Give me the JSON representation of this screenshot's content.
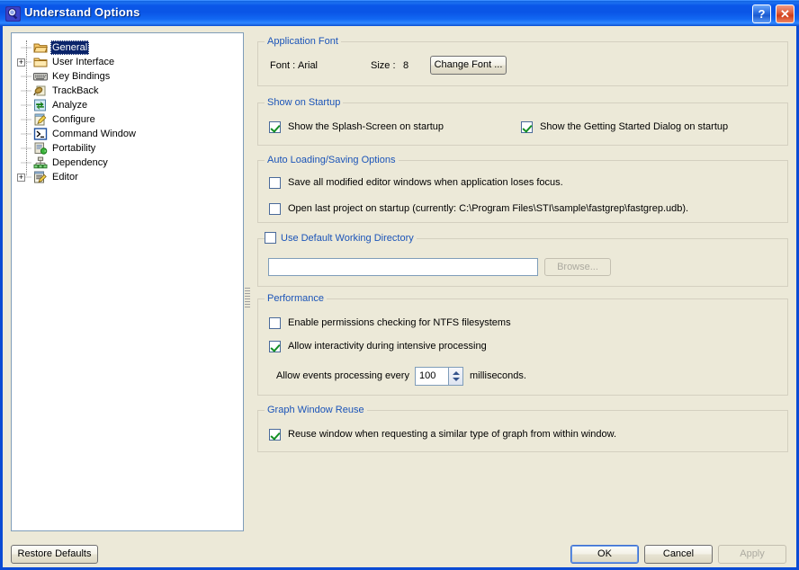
{
  "window": {
    "title": "Understand Options",
    "icon": "magnifier-icon",
    "help_button": "?",
    "close_button": "✕",
    "titlebar_color": "#0a55e6",
    "dialog_bg": "#ece9d8"
  },
  "tree": {
    "items": [
      {
        "label": "General",
        "icon": "folder-open-icon",
        "expander": "",
        "selected": true,
        "indent": 0
      },
      {
        "label": "User Interface",
        "icon": "folder-closed-icon",
        "expander": "+",
        "selected": false,
        "indent": 0
      },
      {
        "label": "Key Bindings",
        "icon": "keyboard-icon",
        "expander": "",
        "selected": false,
        "indent": 0
      },
      {
        "label": "TrackBack",
        "icon": "trackback-icon",
        "expander": "",
        "selected": false,
        "indent": 0
      },
      {
        "label": "Analyze",
        "icon": "analyze-icon",
        "expander": "",
        "selected": false,
        "indent": 0
      },
      {
        "label": "Configure",
        "icon": "configure-icon",
        "expander": "",
        "selected": false,
        "indent": 0
      },
      {
        "label": "Command Window",
        "icon": "command-window-icon",
        "expander": "",
        "selected": false,
        "indent": 0
      },
      {
        "label": "Portability",
        "icon": "portability-icon",
        "expander": "",
        "selected": false,
        "indent": 0
      },
      {
        "label": "Dependency",
        "icon": "dependency-icon",
        "expander": "",
        "selected": false,
        "indent": 0
      },
      {
        "label": "Editor",
        "icon": "editor-icon",
        "expander": "+",
        "selected": false,
        "indent": 0
      }
    ]
  },
  "application_font": {
    "legend": "Application Font",
    "font_label": "Font :",
    "font_value": "Arial",
    "size_label": "Size :",
    "size_value": "8",
    "change_font_button": "Change Font ..."
  },
  "show_on_startup": {
    "legend": "Show on Startup",
    "splash_screen": {
      "label": "Show the Splash-Screen on startup",
      "checked": true
    },
    "getting_started": {
      "label": "Show the Getting Started Dialog on startup",
      "checked": true
    }
  },
  "auto_loading": {
    "legend": "Auto Loading/Saving Options",
    "save_modified": {
      "label": "Save all modified editor windows when application loses focus.",
      "checked": false
    },
    "open_last_project": {
      "label": "Open last project on startup (currently: C:\\Program Files\\STI\\sample\\fastgrep\\fastgrep.udb).",
      "checked": false
    }
  },
  "working_directory": {
    "legend": "Use Default Working Directory",
    "checked": false,
    "path_value": "",
    "browse_button": "Browse..."
  },
  "performance": {
    "legend": "Performance",
    "ntfs_permissions": {
      "label": "Enable permissions checking for NTFS filesystems",
      "checked": false
    },
    "interactivity": {
      "label": "Allow interactivity during intensive processing",
      "checked": true
    },
    "events_prefix": "Allow events processing every",
    "events_value": "100",
    "events_suffix": "milliseconds."
  },
  "graph_window_reuse": {
    "legend": "Graph Window Reuse",
    "reuse_window": {
      "label": "Reuse window when requesting a similar type of graph from within window.",
      "checked": true
    }
  },
  "footer": {
    "restore_defaults": "Restore Defaults",
    "ok": "OK",
    "cancel": "Cancel",
    "apply": "Apply"
  }
}
